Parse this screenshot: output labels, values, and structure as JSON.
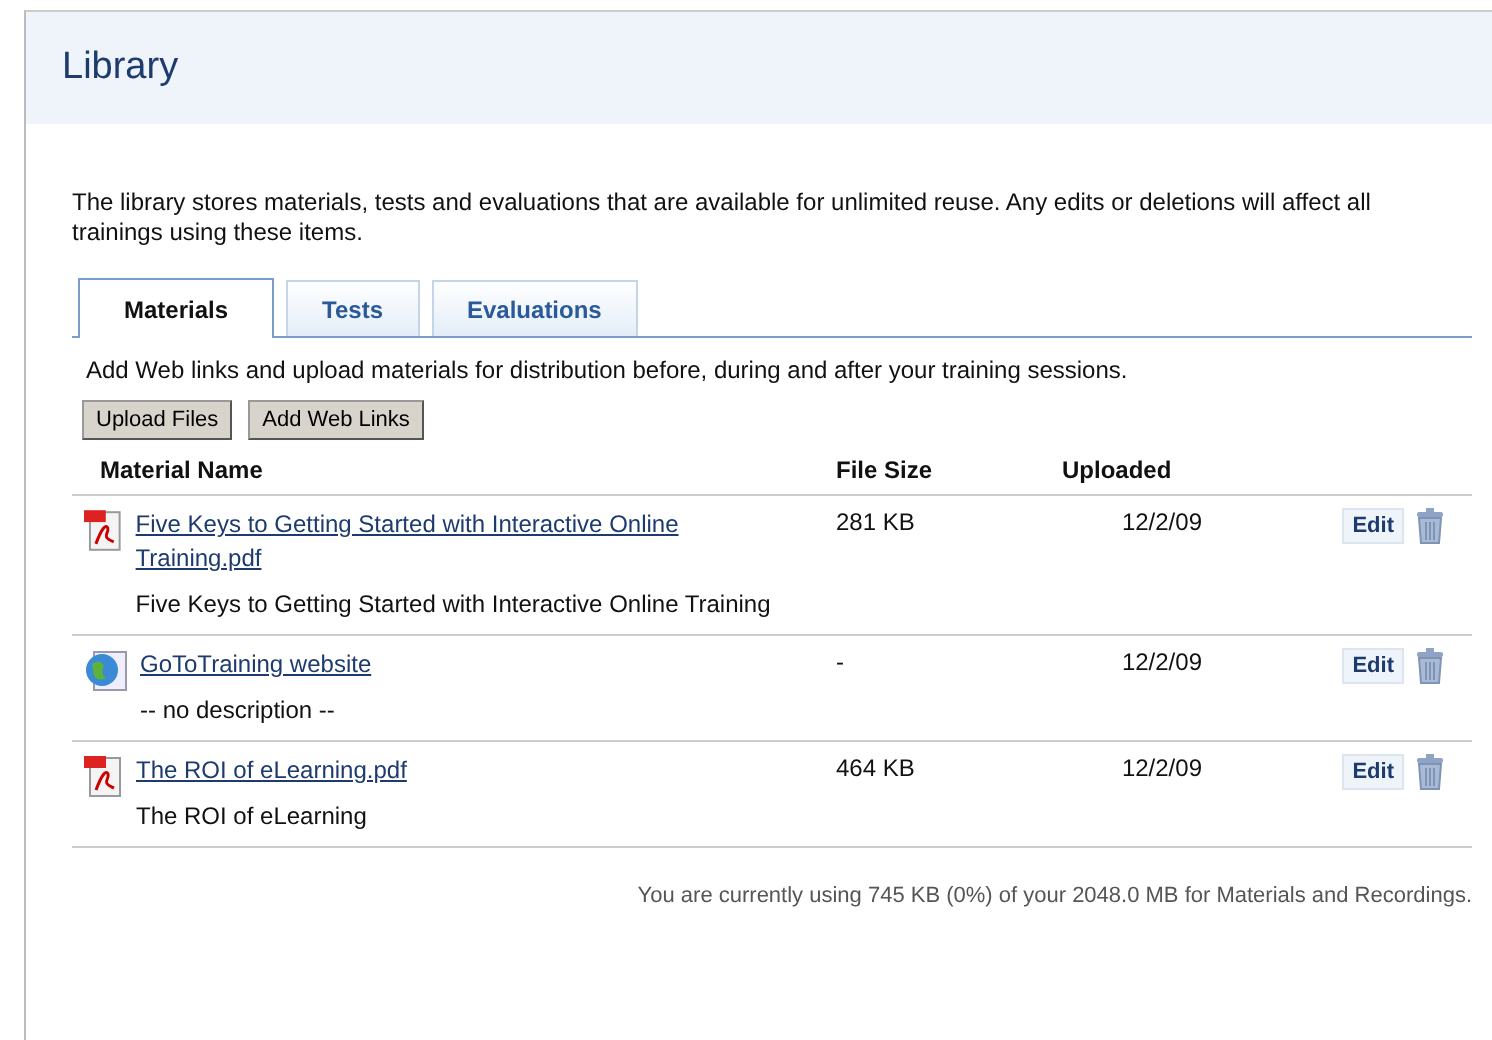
{
  "page": {
    "title": "Library",
    "intro": "The library stores materials, tests and evaluations that are available for unlimited reuse. Any edits or deletions will affect all trainings using these items."
  },
  "tabs": [
    {
      "label": "Materials",
      "selected": true
    },
    {
      "label": "Tests",
      "selected": false
    },
    {
      "label": "Evaluations",
      "selected": false
    }
  ],
  "instructions": "Add Web links and upload materials for distribution before, during and after your training sessions.",
  "buttons": [
    "Upload Files",
    "Add Web Links"
  ],
  "table": {
    "columns": [
      "Material Name",
      "File Size",
      "Uploaded"
    ],
    "rows": [
      {
        "kind": "pdf",
        "name": "Five Keys to Getting Started with Interactive Online Training.pdf",
        "description": "Five Keys to Getting Started with Interactive Online Training",
        "size": "281 KB",
        "uploaded": "12/2/09",
        "edit": "Edit"
      },
      {
        "kind": "web",
        "name": "GoToTraining website",
        "description": "-- no description --",
        "size": "-",
        "uploaded": "12/2/09",
        "edit": "Edit"
      },
      {
        "kind": "pdf",
        "name": "The ROI of eLearning.pdf",
        "description": "The ROI of eLearning",
        "size": "464 KB",
        "uploaded": "12/2/09",
        "edit": "Edit"
      }
    ]
  },
  "usage": "You are currently using 745 KB (0%) of your 2048.0 MB for Materials and Recordings."
}
